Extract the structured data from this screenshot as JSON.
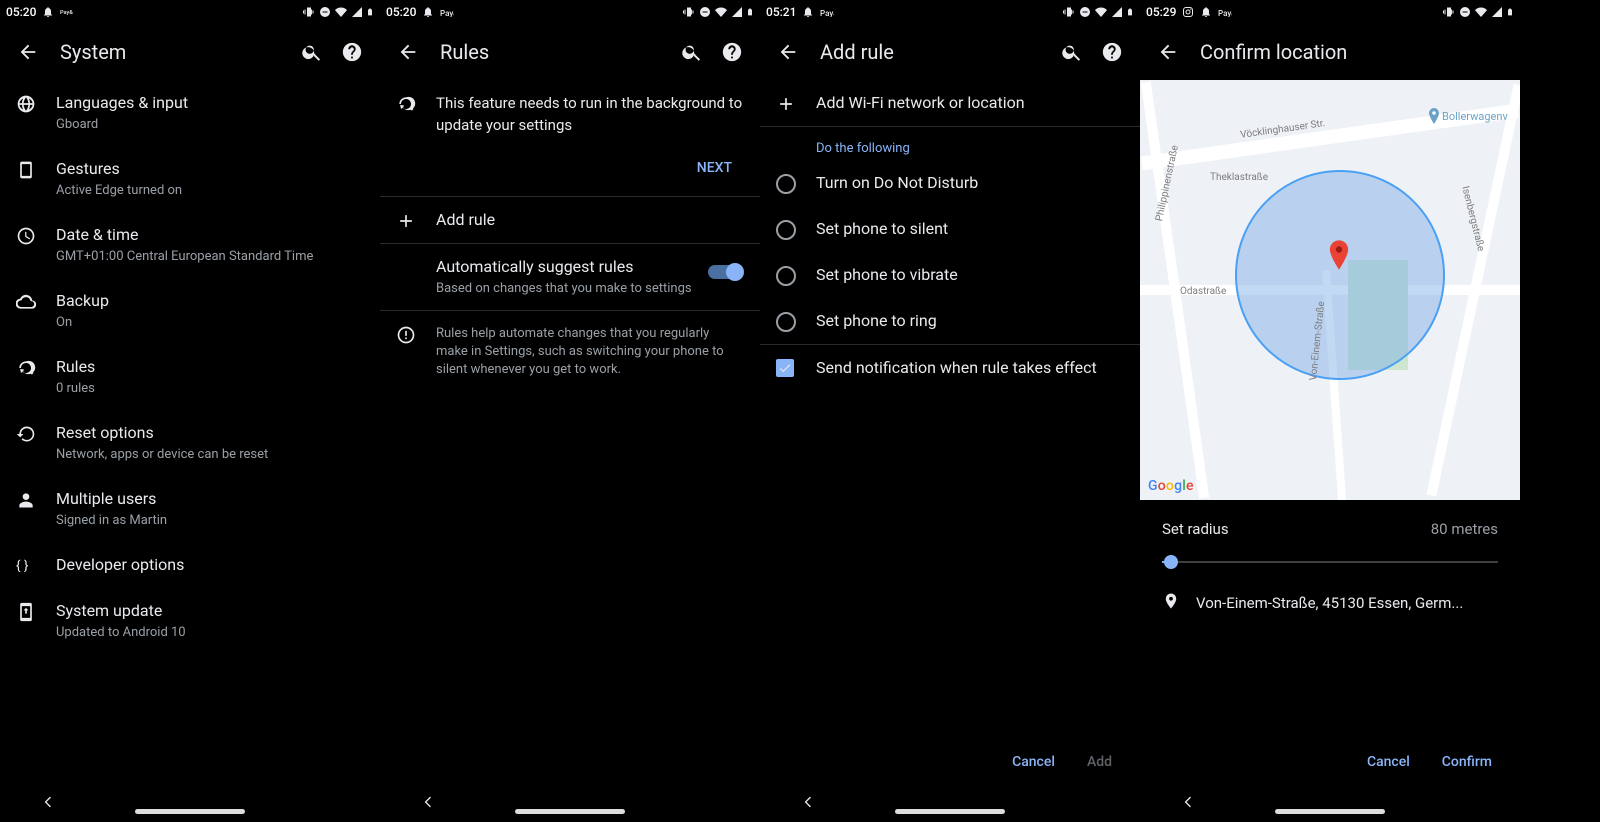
{
  "panes": {
    "system": {
      "time": "05:20",
      "title": "System",
      "items": [
        {
          "title": "Languages & input",
          "sub": "Gboard"
        },
        {
          "title": "Gestures",
          "sub": "Active Edge turned on"
        },
        {
          "title": "Date & time",
          "sub": "GMT+01:00 Central European Standard Time"
        },
        {
          "title": "Backup",
          "sub": "On"
        },
        {
          "title": "Rules",
          "sub": "0 rules"
        },
        {
          "title": "Reset options",
          "sub": "Network, apps or device can be reset"
        },
        {
          "title": "Multiple users",
          "sub": "Signed in as Martin"
        },
        {
          "title": "Developer options",
          "sub": ""
        },
        {
          "title": "System update",
          "sub": "Updated to Android 10"
        }
      ]
    },
    "rules": {
      "time": "05:20",
      "title": "Rules",
      "banner": "This feature needs to run in the background to update your settings",
      "next": "NEXT",
      "add_rule": "Add rule",
      "suggest_title": "Automatically suggest rules",
      "suggest_sub": "Based on changes that you make to settings",
      "info": "Rules help automate changes that you regularly make in Settings, such as switching your phone to silent whenever you get to work."
    },
    "addrule": {
      "time": "05:21",
      "title": "Add rule",
      "add_network": "Add Wi-Fi network or location",
      "section": "Do the following",
      "options": [
        "Turn on Do Not Disturb",
        "Set phone to silent",
        "Set phone to vibrate",
        "Set phone to ring"
      ],
      "notify": "Send notification when rule takes effect",
      "cancel": "Cancel",
      "add": "Add"
    },
    "confirm": {
      "time": "05:29",
      "title": "Confirm location",
      "radius_label": "Set radius",
      "radius_value": "80 metres",
      "address": "Von-Einem-Straße, 45130 Essen, Germ...",
      "cancel": "Cancel",
      "confirm": "Confirm",
      "map": {
        "poi": "Bollerwagenv",
        "streets": [
          "Vöcklinghauser Str.",
          "Theklastraße",
          "Philippinenstraße",
          "Odastraße",
          "Von-Einem-Straße",
          "Isenbergstraße"
        ]
      }
    }
  }
}
